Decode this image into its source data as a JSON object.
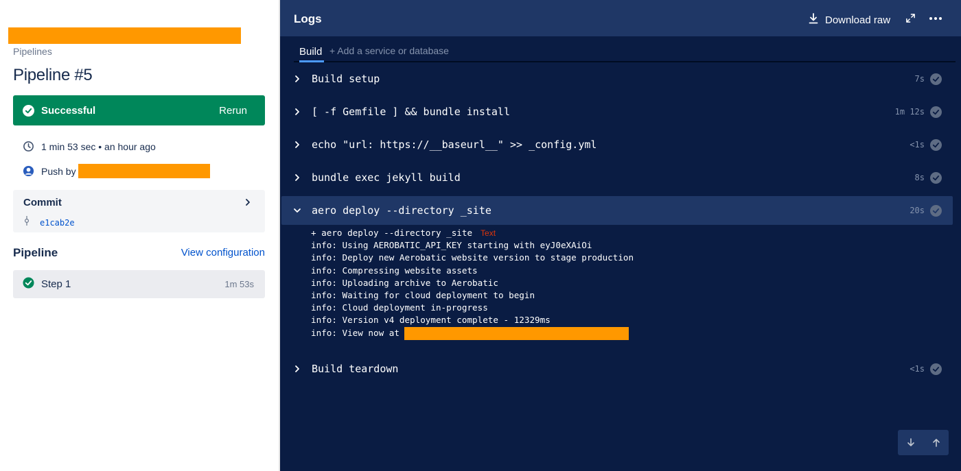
{
  "left": {
    "breadcrumb": "Pipelines",
    "title": "Pipeline #5",
    "status": {
      "label": "Successful",
      "action": "Rerun",
      "color": "#00875a"
    },
    "duration": "1 min 53 sec • an hour ago",
    "push_by": "Push by",
    "commit": {
      "label": "Commit",
      "hash": "e1cab2e"
    },
    "pipeline_heading": "Pipeline",
    "view_config": "View configuration",
    "steps": [
      {
        "name": "Step 1",
        "time": "1m 53s"
      }
    ]
  },
  "logs": {
    "title": "Logs",
    "download": "Download raw",
    "tabs": {
      "build": "Build",
      "add": "+ Add a service or database"
    },
    "rows": [
      {
        "cmd": "Build setup",
        "dur": "7s"
      },
      {
        "cmd": "[ -f Gemfile ] && bundle install",
        "dur": "1m 12s"
      },
      {
        "cmd": "echo \"url: https://__baseurl__\" >> _config.yml",
        "dur": "<1s"
      },
      {
        "cmd": "bundle exec jekyll build",
        "dur": "8s"
      },
      {
        "cmd": "aero deploy --directory _site",
        "dur": "20s"
      },
      {
        "cmd": "Build teardown",
        "dur": "<1s"
      }
    ],
    "output": [
      "+ aero deploy --directory _site",
      "info: Using AEROBATIC_API_KEY starting with eyJ0eXAiOi",
      "info: Deploy new Aerobatic website version to stage production",
      "info: Compressing website assets",
      "info: Uploading archive to Aerobatic",
      "info: Waiting for cloud deployment to begin",
      "info: Cloud deployment in-progress",
      "info: Version v4 deployment complete - 12329ms",
      "info: View now at "
    ],
    "text_tag": "Text"
  },
  "colors": {
    "logs_bg": "#0a1c43",
    "header_bg": "#1f3766",
    "accent": "#4c9aff",
    "link": "#0052cc",
    "redaction": "#ff9800"
  }
}
